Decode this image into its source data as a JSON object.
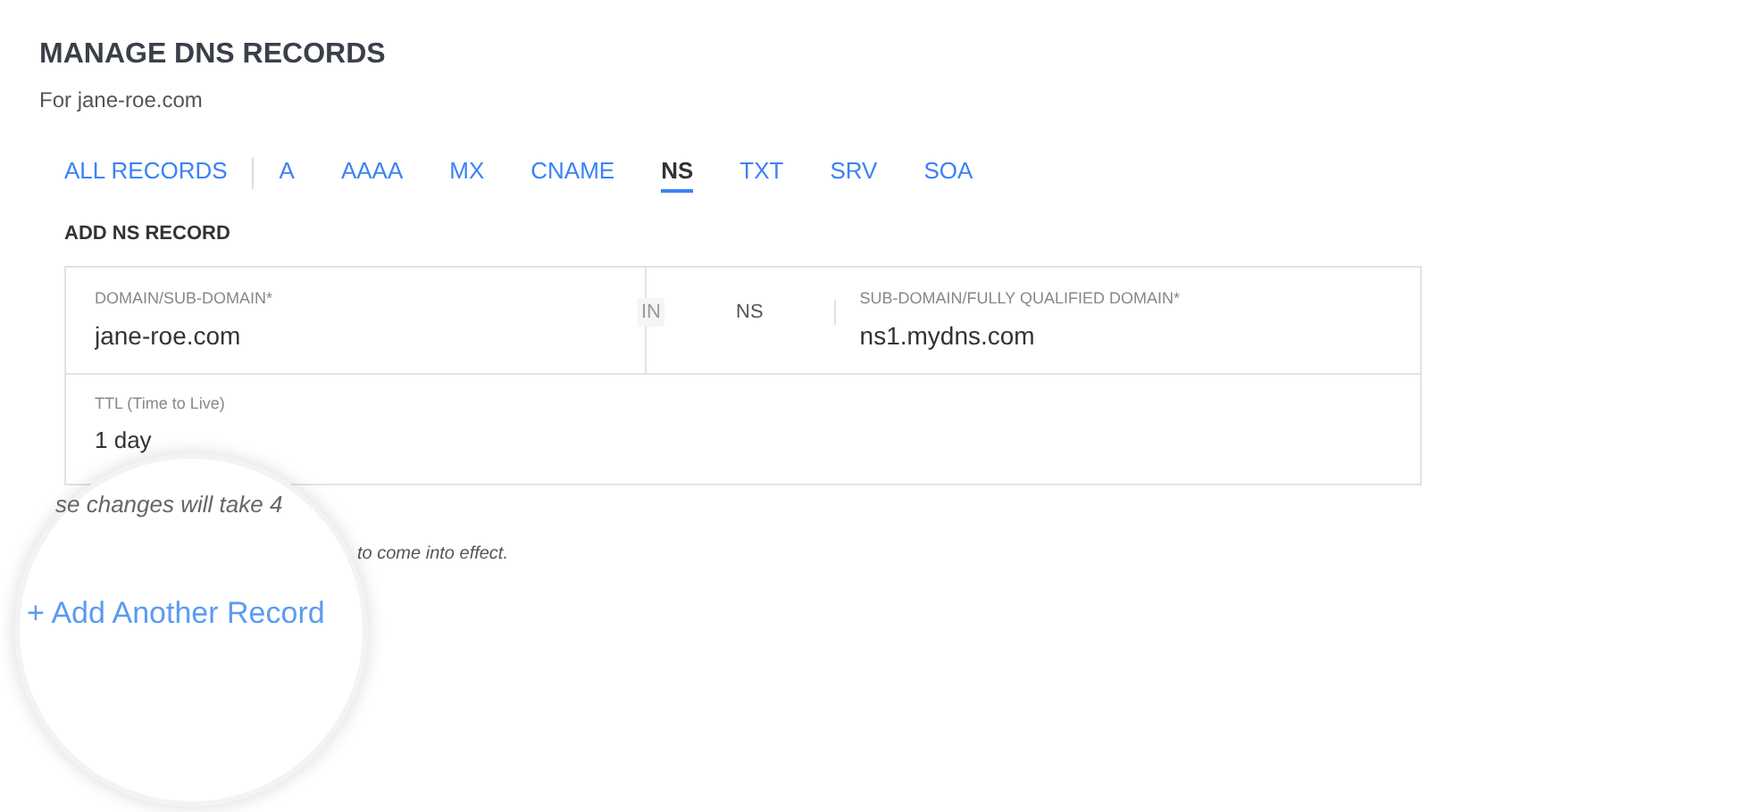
{
  "title": "MANAGE DNS RECORDS",
  "subtitle": "For jane-roe.com",
  "tabs": [
    {
      "label": "ALL RECORDS",
      "selected": false
    },
    {
      "label": "A",
      "selected": false
    },
    {
      "label": "AAAA",
      "selected": false
    },
    {
      "label": "MX",
      "selected": false
    },
    {
      "label": "CNAME",
      "selected": false
    },
    {
      "label": "NS",
      "selected": true
    },
    {
      "label": "TXT",
      "selected": false
    },
    {
      "label": "SRV",
      "selected": false
    },
    {
      "label": "SOA",
      "selected": false
    }
  ],
  "form": {
    "heading": "ADD NS RECORD",
    "domain_field": {
      "label": "DOMAIN/SUB-DOMAIN*",
      "value": "jane-roe.com"
    },
    "class": "IN",
    "type": "NS",
    "target_field": {
      "label": "SUB-DOMAIN/FULLY QUALIFIED DOMAIN*",
      "value": "ns1.mydns.com"
    },
    "ttl_field": {
      "label": "TTL (Time to Live)",
      "value": "1 day"
    }
  },
  "notice_tail": "to come into effect.",
  "magnifier": {
    "notice": "se changes will take 4",
    "link": "+ Add Another Record"
  }
}
